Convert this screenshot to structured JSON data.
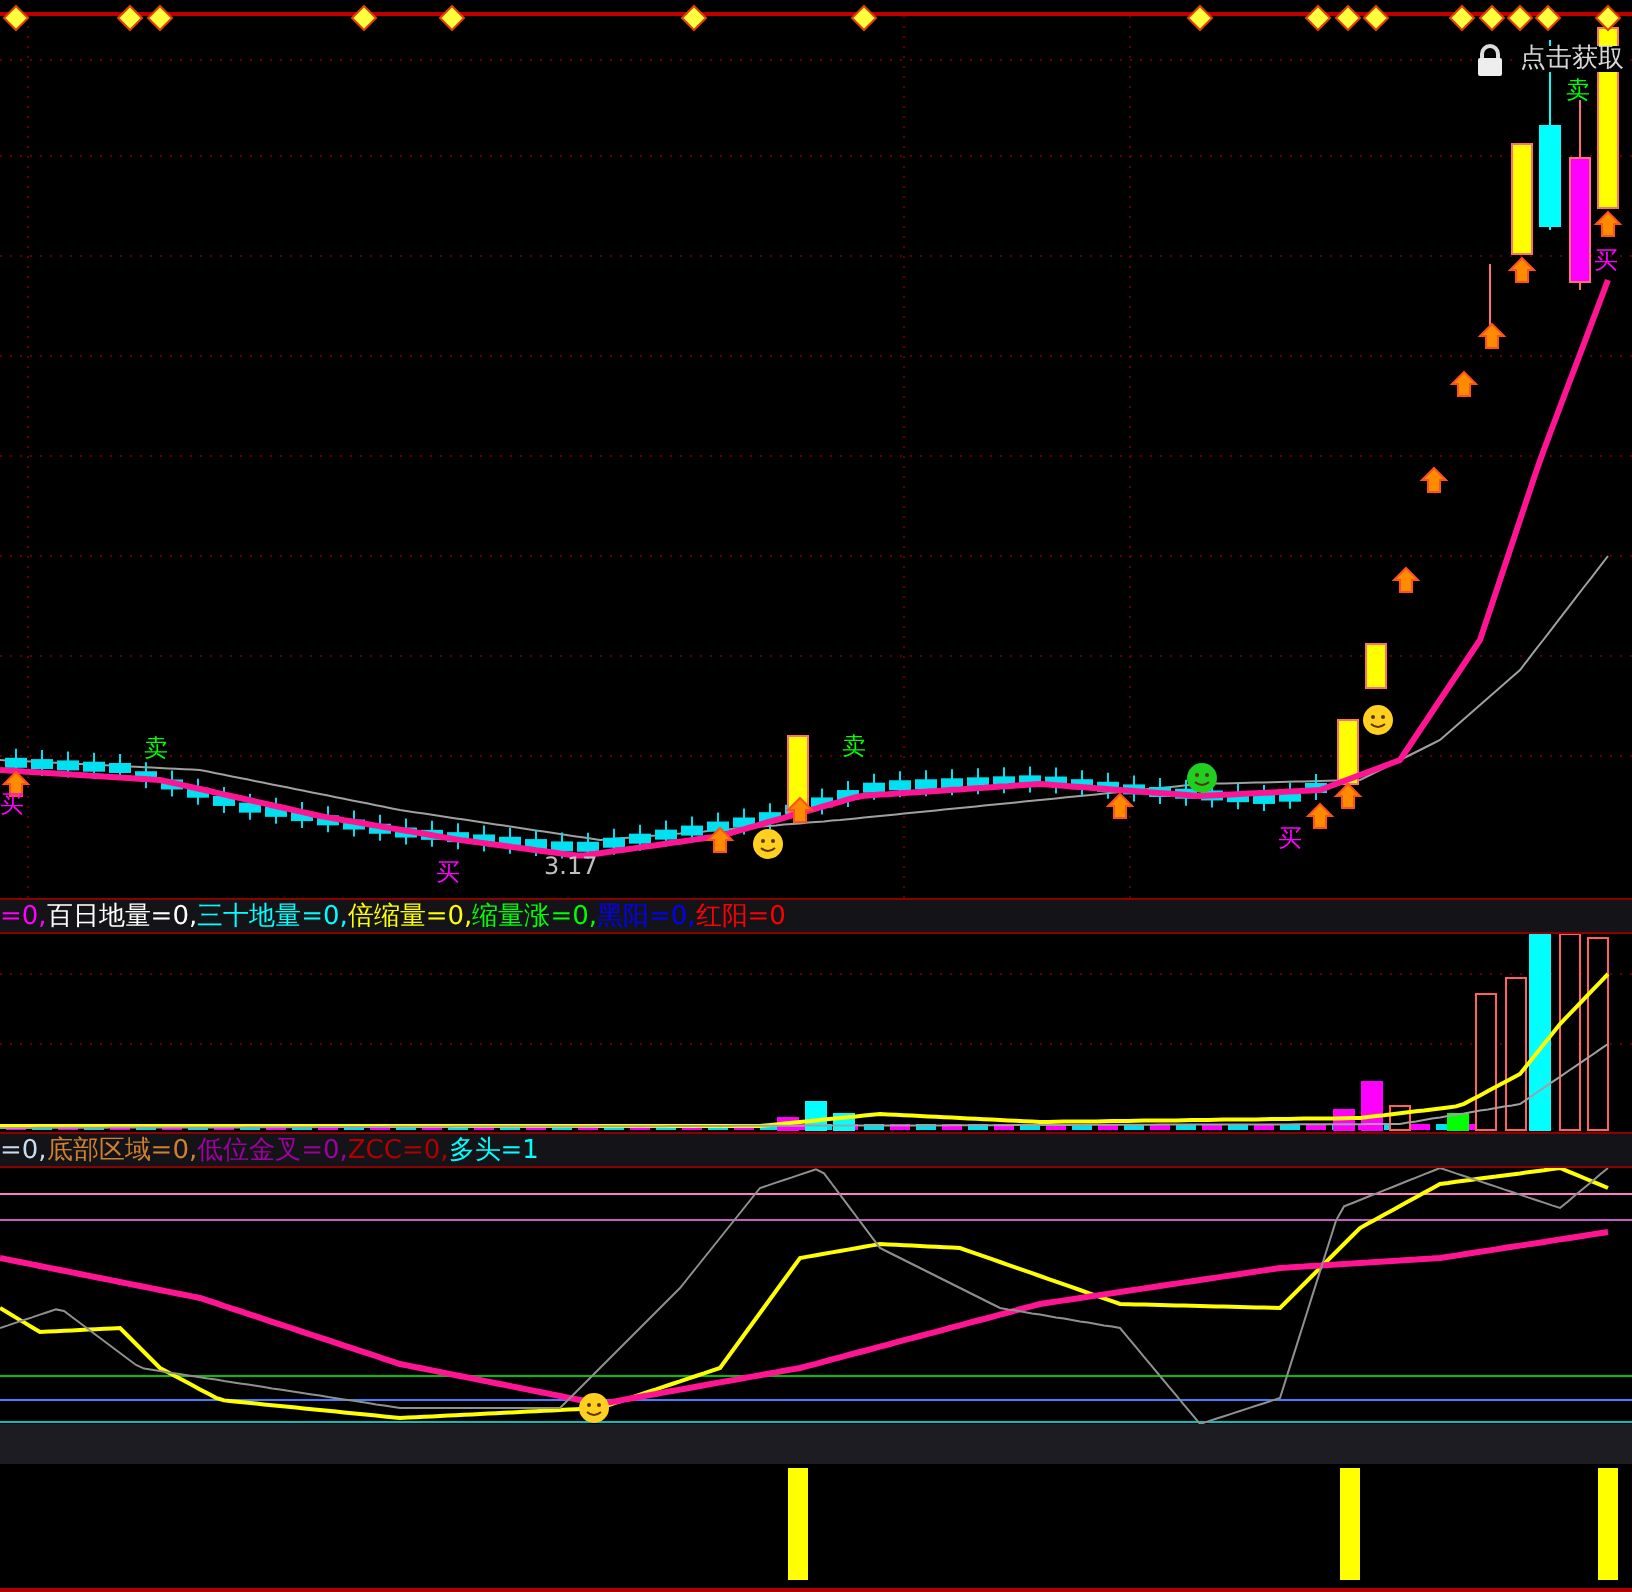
{
  "main_chart": {
    "notice": "点击获取",
    "price_label": "3.17",
    "signals": [
      {
        "text": "买",
        "kind": "buy"
      },
      {
        "text": "卖",
        "kind": "sell"
      },
      {
        "text": "买",
        "kind": "buy"
      },
      {
        "text": "卖",
        "kind": "sell"
      },
      {
        "text": "买",
        "kind": "buy"
      },
      {
        "text": "卖",
        "kind": "sell"
      },
      {
        "text": "买",
        "kind": "buy"
      }
    ]
  },
  "volume_panel": {
    "legend": [
      {
        "text": "=0,",
        "color": "#ff00ff"
      },
      {
        "text": "百日地量=0,",
        "color": "#ffffff"
      },
      {
        "text": "三十地量=0,",
        "color": "#00ffff"
      },
      {
        "text": "倍缩量=0,",
        "color": "#ffff00"
      },
      {
        "text": "缩量涨=0,",
        "color": "#00ff00"
      },
      {
        "text": "黑阳=0,",
        "color": "#0000ff"
      },
      {
        "text": "红阳=0",
        "color": "#ff0000"
      }
    ]
  },
  "indicator_panel": {
    "legend": [
      {
        "text": "=0,",
        "color": "#c8dcf0"
      },
      {
        "text": "底部区域=0,",
        "color": "#d08030"
      },
      {
        "text": "低位金叉=0,",
        "color": "#a000a0"
      },
      {
        "text": "ZCC=0,",
        "color": "#b00000"
      },
      {
        "text": "多头=1",
        "color": "#00ffff"
      }
    ]
  }
}
